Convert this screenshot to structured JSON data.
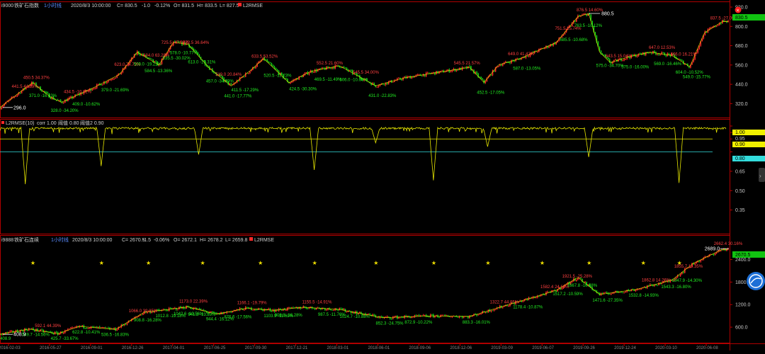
{
  "colors": {
    "bg": "#000000",
    "frame": "#b00000",
    "up": "#ff2a2a",
    "down": "#16d316",
    "ma": "#e6e600",
    "cyan": "#33dddd",
    "label_red": "#ff4040",
    "label_green": "#22ee22",
    "axis_text": "#c8c8c8",
    "header": "#d0d0d0",
    "title_blue": "#5a8cff"
  },
  "panes": [
    {
      "header": {
        "code": "i9000",
        "name": "铁矿石指数",
        "period": "1小时线",
        "datetime": "2020/8/3 10:00:00",
        "close": "C= 830.5",
        "change": "-1.0",
        "pct": "-0.12%",
        "open": "O= 831.5",
        "high": "H= 833.5",
        "low": "L= 827.5",
        "indicator": "L2RMSE"
      },
      "y_ticks": [
        "920.0",
        "800.0",
        "680.0",
        "560.0",
        "440.0",
        "320.0"
      ],
      "last_price": "830.5",
      "ylim": [
        260,
        920
      ],
      "low_marker": "296.0",
      "high_marker": "880.5",
      "labels_red": [
        {
          "i": 44,
          "t": "450.5 34.37%"
        },
        {
          "i": 28,
          "t": "441.5 44.39%"
        },
        {
          "i": 100,
          "t": "434.5 -10.62%"
        },
        {
          "i": 170,
          "t": "623.0 74.72%"
        },
        {
          "i": 210,
          "t": "634.0 63.28%"
        },
        {
          "i": 235,
          "t": "725.5 -47.07%"
        },
        {
          "i": 265,
          "t": "672.5 36.64%"
        },
        {
          "i": 310,
          "t": "519.0 20.84%"
        },
        {
          "i": 360,
          "t": "633.5 53.52%"
        },
        {
          "i": 450,
          "t": "552.5 21.60%"
        },
        {
          "i": 500,
          "t": "545.5 34.00%"
        },
        {
          "i": 640,
          "t": "545.5 21.57%"
        },
        {
          "i": 715,
          "t": "649.0 41.42%"
        },
        {
          "i": 780,
          "t": "751.5 25.74%"
        },
        {
          "i": 810,
          "t": "876.5 14.60%"
        },
        {
          "i": 850,
          "t": "643.5 15.04%"
        },
        {
          "i": 910,
          "t": "647.0 12.53%"
        },
        {
          "i": 940,
          "t": "666.0 16.21%"
        },
        {
          "i": 995,
          "t": "837.5 -27.09%"
        }
      ],
      "labels_green": [
        {
          "i": 50,
          "t": "371.0 -16.63%"
        },
        {
          "i": 80,
          "t": "328.0 -34.20%"
        },
        {
          "i": 110,
          "t": "409.0 -10.62%"
        },
        {
          "i": 150,
          "t": "379.0 -21.69%"
        },
        {
          "i": 195,
          "t": "509.0 -19.22%"
        },
        {
          "i": 210,
          "t": "584.5 -13.36%"
        },
        {
          "i": 235,
          "t": "535.5 -30.02%"
        },
        {
          "i": 245,
          "t": "578.0 -10.77%"
        },
        {
          "i": 270,
          "t": "613.0 -15.31%"
        },
        {
          "i": 295,
          "t": "457.0 -34.93%"
        },
        {
          "i": 320,
          "t": "441.0 -17.77%"
        },
        {
          "i": 330,
          "t": "411.5 -17.29%"
        },
        {
          "i": 375,
          "t": "520.5 -12.23%"
        },
        {
          "i": 410,
          "t": "424.5 -30.30%"
        },
        {
          "i": 445,
          "t": "469.5 -11.49%"
        },
        {
          "i": 480,
          "t": "506.0 -10.60%"
        },
        {
          "i": 520,
          "t": "431.0 -22.83%"
        },
        {
          "i": 670,
          "t": "452.5 -17.05%"
        },
        {
          "i": 720,
          "t": "587.0 -13.05%"
        },
        {
          "i": 785,
          "t": "685.5 -10.68%"
        },
        {
          "i": 805,
          "t": "763.5 -10.12%"
        },
        {
          "i": 835,
          "t": "575.0 -34.70%"
        },
        {
          "i": 870,
          "t": "575.0 -16.00%"
        },
        {
          "i": 915,
          "t": "569.0 -16.46%"
        },
        {
          "i": 945,
          "t": "604.0 -10.52%"
        },
        {
          "i": 955,
          "t": "549.0 -15.77%"
        }
      ]
    },
    {
      "header": {
        "indicator": "L2RMSE(10)",
        "corr": "corr 1.00",
        "th1": "阈值 0.80",
        "th2": "阈值2 0.90"
      },
      "y_ticks": [
        "1.00",
        "0.95",
        "0.90",
        "0.80",
        "0.65",
        "0.50",
        "0.35"
      ],
      "tag_values": [
        "1.00",
        "0.95",
        "0.90",
        "0.80"
      ]
    },
    {
      "header": {
        "code": "i9888",
        "name": "铁矿石连续",
        "period": "1小时线",
        "datetime": "2020/8/3 10:00:00",
        "close": "C= 2670.5",
        "change": "-1.5",
        "pct": "-0.06%",
        "open": "O= 2672.1",
        "high": "H= 2678.2",
        "low": "L= 2659.8",
        "indicator": "L2RMSE"
      },
      "y_ticks": [
        "2400.0",
        "1800.0",
        "1200.0",
        "600.0"
      ],
      "last_price": "2670.5",
      "ylim": [
        300,
        2900
      ],
      "low_marker": "408.9",
      "high_marker": "2689.0",
      "star_glyph": "★",
      "labels_red": [
        {
          "i": 60,
          "t": "592.1 44.39%"
        },
        {
          "i": 190,
          "t": "1066.0 39.35%"
        },
        {
          "i": 260,
          "t": "1173.0 22.39%"
        },
        {
          "i": 340,
          "t": "1166.1 -19.79%"
        },
        {
          "i": 430,
          "t": "1155.5 -14.91%"
        },
        {
          "i": 690,
          "t": "1322.7 44.05%"
        },
        {
          "i": 760,
          "t": "1582.4 24.63%"
        },
        {
          "i": 790,
          "t": "1921.5 -25.28%"
        },
        {
          "i": 900,
          "t": "1862.8 14.26%"
        },
        {
          "i": 945,
          "t": "1855.7 13.35%"
        },
        {
          "i": 1000,
          "t": "2662.4 30.16%"
        }
      ],
      "labels_green": [
        {
          "i": 10,
          "t": "408.9"
        },
        {
          "i": 40,
          "t": "549.7 -14.56%"
        },
        {
          "i": 80,
          "t": "425.7 -33.67%"
        },
        {
          "i": 110,
          "t": "622.8 -10.41%"
        },
        {
          "i": 150,
          "t": "536.5 -16.83%"
        },
        {
          "i": 195,
          "t": "908.8 -16.28%"
        },
        {
          "i": 225,
          "t": "1012.8 -19.18%"
        },
        {
          "i": 250,
          "t": "1042.6 -10.56%"
        },
        {
          "i": 270,
          "t": "941.3 -13.89%"
        },
        {
          "i": 295,
          "t": "944.4 -16.12%"
        },
        {
          "i": 320,
          "t": "876.6 -17.56%"
        },
        {
          "i": 375,
          "t": "1103.9 -11.62%"
        },
        {
          "i": 390,
          "t": "908.8 -16.28%"
        },
        {
          "i": 450,
          "t": "987.5 -11.76%"
        },
        {
          "i": 480,
          "t": "1024.7 -10.88%"
        },
        {
          "i": 530,
          "t": "852.3 -24.75%"
        },
        {
          "i": 570,
          "t": "872.9 -10.22%"
        },
        {
          "i": 650,
          "t": "883.3 -16.01%"
        },
        {
          "i": 720,
          "t": "1178.4 -10.87%"
        },
        {
          "i": 775,
          "t": "1517.2 -10.59%"
        },
        {
          "i": 795,
          "t": "1667.8 -10.48%"
        },
        {
          "i": 830,
          "t": "1471.6 -27.35%"
        },
        {
          "i": 880,
          "t": "1532.8 -14.93%"
        },
        {
          "i": 925,
          "t": "1543.3 -16.80%"
        },
        {
          "i": 940,
          "t": "1847.9 -14.30%"
        }
      ]
    }
  ],
  "x_labels": [
    "2016-02-03",
    "2016-05-27",
    "2016-09-01",
    "2016-12-26",
    "2017-04-01",
    "2017-06-25",
    "2017-09-30",
    "2017-12-21",
    "2018-03-01",
    "2018-06-01",
    "2018-09-06",
    "2018-12-06",
    "2019-03-09",
    "2019-06-07",
    "2019-09-26",
    "2019-12-24",
    "2020-03-10",
    "2020-06-08"
  ],
  "chart_data": [
    {
      "type": "line",
      "title": "i9000 铁矿石指数 1小时线",
      "ylim": [
        260,
        920
      ],
      "y_ticks": [
        920,
        800,
        680,
        560,
        440,
        320
      ],
      "x_ticks": [
        "2016-02-03",
        "2016-05-27",
        "2016-09-01",
        "2016-12-26",
        "2017-04-01",
        "2017-06-25",
        "2017-09-30",
        "2017-12-21",
        "2018-03-01",
        "2018-06-01",
        "2018-09-06",
        "2018-12-06",
        "2019-03-09",
        "2019-06-07",
        "2019-09-26",
        "2019-12-24",
        "2020-03-10",
        "2020-06-08"
      ],
      "series": [
        {
          "name": "L2RMSE",
          "x": [
            0,
            30,
            45,
            70,
            85,
            130,
            165,
            190,
            220,
            240,
            260,
            290,
            320,
            345,
            365,
            400,
            430,
            470,
            520,
            560,
            600,
            650,
            670,
            690,
            720,
            770,
            800,
            815,
            830,
            845,
            870,
            900,
            930,
            955,
            975,
            1000
          ],
          "values": [
            296,
            400,
            450,
            360,
            328,
            420,
            500,
            640,
            560,
            700,
            690,
            540,
            430,
            520,
            600,
            450,
            520,
            555,
            431,
            480,
            510,
            545,
            452,
            560,
            600,
            700,
            860,
            880,
            640,
            575,
            610,
            640,
            620,
            549,
            760,
            830
          ]
        }
      ]
    },
    {
      "type": "line",
      "title": "L2RMSE(10)",
      "ylim": [
        0.2,
        1.05
      ],
      "y_ticks": [
        1.0,
        0.95,
        0.9,
        0.8,
        0.65,
        0.5,
        0.35
      ],
      "thresholds": [
        0.8,
        0.9
      ],
      "series": [
        {
          "name": "L2RMSE(10)",
          "dips": [
            {
              "x": 35,
              "v": 0.55
            },
            {
              "x": 140,
              "v": 0.69
            },
            {
              "x": 275,
              "v": 0.78
            },
            {
              "x": 435,
              "v": 0.66
            },
            {
              "x": 520,
              "v": 0.87
            },
            {
              "x": 600,
              "v": 0.58
            },
            {
              "x": 675,
              "v": 0.84
            },
            {
              "x": 815,
              "v": 0.76
            },
            {
              "x": 940,
              "v": 0.56
            }
          ],
          "base": 0.99
        }
      ]
    },
    {
      "type": "line",
      "title": "i9888 铁矿石连续 1小时线",
      "ylim": [
        300,
        2900
      ],
      "y_ticks": [
        2400,
        1800,
        1200,
        600
      ],
      "series": [
        {
          "name": "L2RMSE",
          "x": [
            0,
            40,
            80,
            110,
            160,
            200,
            230,
            260,
            300,
            340,
            380,
            420,
            470,
            530,
            600,
            650,
            700,
            740,
            770,
            800,
            830,
            880,
            930,
            960,
            1000
          ],
          "values": [
            409,
            550,
            426,
            620,
            540,
            1000,
            1060,
            1140,
            944,
            1100,
            1050,
            1130,
            1070,
            852,
            900,
            883,
            1178,
            1400,
            1580,
            1920,
            1471,
            1600,
            1850,
            2300,
            2670
          ]
        }
      ],
      "stars_x": [
        45,
        140,
        205,
        280,
        360,
        435,
        520,
        600,
        675,
        750,
        815,
        890,
        940
      ]
    }
  ]
}
